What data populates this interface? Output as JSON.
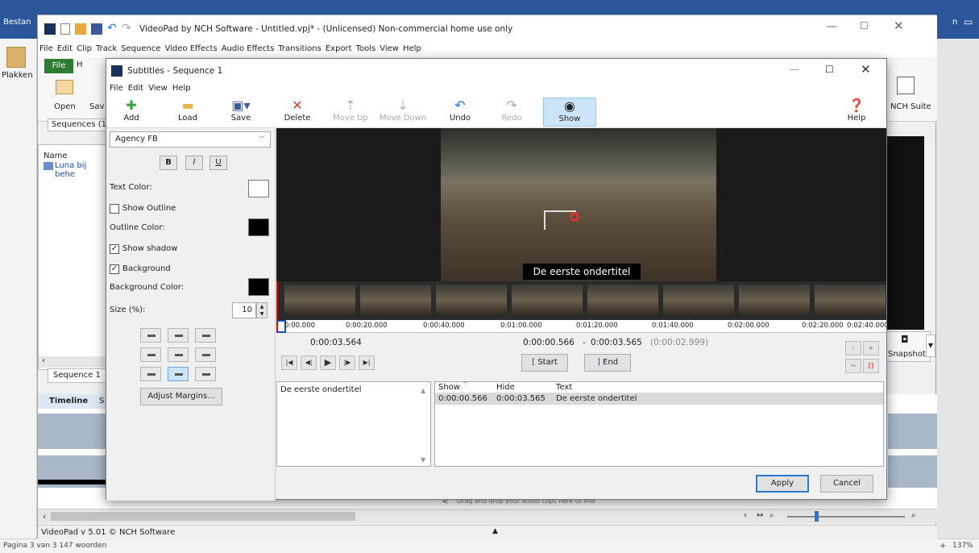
{
  "word": {
    "tab_file": "Bestan",
    "paste": "Plakken",
    "right_tab": "n",
    "status": "Pagina 3 van 3   147 woorden",
    "zoom": "137%"
  },
  "videopad": {
    "title": "VideoPad by NCH Software - Untitled.vpj* - (Unlicensed) Non-commercial home use only",
    "menu": [
      "File",
      "Edit",
      "Clip",
      "Track",
      "Sequence",
      "Video Effects",
      "Audio Effects",
      "Transitions",
      "Export",
      "Tools",
      "View",
      "Help"
    ],
    "ribbon_file": "File",
    "ribbon_h": "H",
    "open": "Open",
    "save_partial": "Sav",
    "nch_suite": "NCH Suite",
    "sequences_tab": "Sequences",
    "sequences_count": "(1",
    "name_header": "Name",
    "clip_name": "Luna bij behe",
    "sequence_tab": "Sequence 1",
    "timeline_tab": "Timeline",
    "timeline_tab2": "S",
    "snapshot": "Snapshot",
    "drag_audio": "Drag and drop your audio clips here to mix",
    "version": "VideoPad v 5.01 © NCH Software"
  },
  "dialog": {
    "title": "Subtitles - Sequence 1",
    "menu": [
      "File",
      "Edit",
      "View",
      "Help"
    ],
    "toolbar": {
      "add": "Add",
      "load": "Load",
      "save": "Save",
      "delete": "Delete",
      "move_up": "Move Up",
      "move_down": "Move Down",
      "undo": "Undo",
      "redo": "Redo",
      "show": "Show",
      "help": "Help"
    },
    "font": "Agency FB",
    "bold": "B",
    "italic": "I",
    "underline": "U",
    "text_color_label": "Text Color:",
    "show_outline_label": "Show Outline",
    "show_outline_checked": false,
    "outline_color_label": "Outline Color:",
    "show_shadow_label": "Show shadow",
    "show_shadow_checked": true,
    "background_label": "Background",
    "background_checked": true,
    "background_color_label": "Background Color:",
    "size_label": "Size (%):",
    "size_value": "10",
    "adjust_margins": "Adjust Margins...",
    "colors": {
      "text": "#ffffff",
      "outline": "#000000",
      "background": "#000000"
    },
    "caption": "De eerste ondertitel",
    "ruler_ticks": [
      "0:00.000",
      "0:00:20.000",
      "0:00:40.000",
      "0:01:00.000",
      "0:01:20.000",
      "0:01:40.000",
      "0:02:00.000",
      "0:02:20.000",
      "0:02:40.000"
    ],
    "current_time": "0:00:03.564",
    "range_start": "0:00:00.566",
    "range_sep": "-",
    "range_end": "0:00:03.565",
    "range_duration": "(0:00:02.999)",
    "start_btn": "Start",
    "end_btn": "End",
    "edit_text": "De eerste ondertitel",
    "table": {
      "headers": [
        "Show",
        "Hide",
        "Text"
      ],
      "rows": [
        [
          "0:00:00.566",
          "0:00:03.565",
          "De eerste ondertitel"
        ]
      ]
    },
    "apply": "Apply",
    "cancel": "Cancel"
  }
}
